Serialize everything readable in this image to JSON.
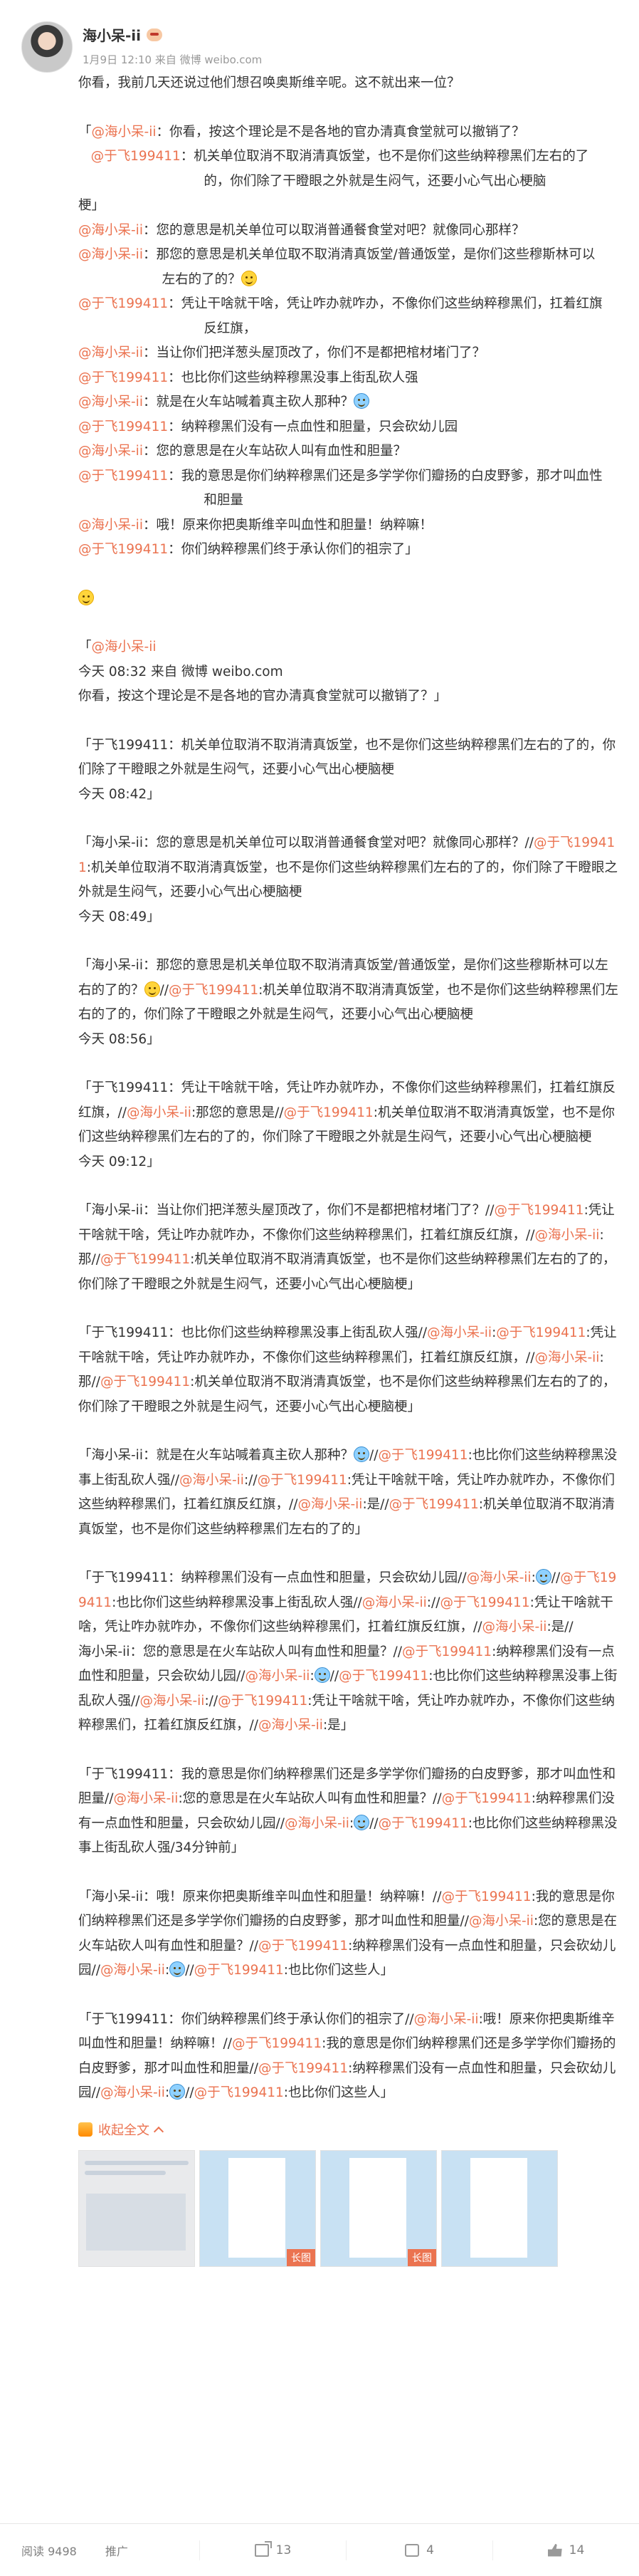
{
  "post": {
    "username": "海小呆-ii",
    "time_source": "1月9日 12:10 来自 微博 weibo.com",
    "icons": {
      "avatar": "avatar",
      "badge": "badge-icon",
      "emoji": "smile-emoji",
      "cry": "laugh-cry-emoji"
    }
  },
  "body": {
    "p01": "你看，我前几天还说过他们想召唤奥斯维辛呢。这不就出来一位？",
    "p02_a": "「",
    "p02_m1": "@海小呆-ii",
    "p02_b": "：你看，按这个理论是不是各地的官办清真食堂就可以撤销了？\n   ",
    "p02_m2": "@于飞199411",
    "p02_c": "：机关单位取消不取消清真饭堂，也不是你们这些纳粹穆黑们左右的了\n                              的，你们除了干瞪眼之外就是生闷气，还要小心气出心梗脑\n梗」",
    "p03_m": "@海小呆-ii",
    "p03_t": "：您的意思是机关单位可以取消普通餐食堂对吧？就像同心那样？",
    "p04_m": "@海小呆-ii",
    "p04_t": "：那您的意思是机关单位取不取消清真饭堂/普通饭堂，是你们这些穆斯林可以\n                    左右的了的？",
    "p05_m": "@于飞199411",
    "p05_t": "：凭让干啥就干啥，凭让咋办就咋办，不像你们这些纳粹穆黑们，扛着红旗\n                              反红旗，",
    "p06_m": "@海小呆-ii",
    "p06_t": "：当让你们把洋葱头屋顶改了，你们不是都把棺材堵门了？",
    "p07_m": "@于飞199411",
    "p07_t": "：也比你们这些纳粹穆黑没事上街乱砍人强",
    "p08_m": "@海小呆-ii",
    "p08_t": "：就是在火车站喊着真主砍人那种？",
    "p09_m": "@于飞199411",
    "p09_t": "：纳粹穆黑们没有一点血性和胆量，只会砍幼儿园",
    "p10_m": "@海小呆-ii",
    "p10_t": "：您的意思是在火车站砍人叫有血性和胆量？",
    "p11_m": "@于飞199411",
    "p11_t": "：我的意思是你们纳粹穆黑们还是多学学你们瓣扬的白皮野爹，那才叫血性\n                              和胆量",
    "p12_m": "@海小呆-ii",
    "p12_t": "：哦！原来你把奥斯维辛叫血性和胆量！纳粹嘛！",
    "p13_m": "@于飞199411",
    "p13_t": "：你们纳粹穆黑们终于承认你们的祖宗了」",
    "q01_m": "@海小呆-ii",
    "q01_time": "今天 08:32 来自 微博 weibo.com",
    "q01_t": "你看，按这个理论是不是各地的官办清真食堂就可以撤销了？」",
    "q02": "「于飞199411：机关单位取消不取消清真饭堂，也不是你们这些纳粹穆黑们左右的了的，你们除了干瞪眼之外就是生闷气，还要小心气出心梗脑梗",
    "q02_time": "今天 08:42」",
    "q03_a": "「海小呆-ii：您的意思是机关单位可以取消普通餐食堂对吧？就像同心那样？//",
    "q03_m": "@于飞199411",
    "q03_b": ":机关单位取消不取消清真饭堂，也不是你们这些纳粹穆黑们左右的了的，你们除了干瞪眼之外就是生闷气，还要小心气出心梗脑梗",
    "q03_time": "今天 08:49」",
    "q04_a": "「海小呆-ii：那您的意思是机关单位取不取消清真饭堂/普通饭堂，是你们这些穆斯林可以左右的了的？",
    "q04_b": "//",
    "q04_m": "@于飞199411",
    "q04_c": ":机关单位取消不取消清真饭堂，也不是你们这些纳粹穆黑们左右的了的，你们除了干瞪眼之外就是生闷气，还要小心气出心梗脑梗",
    "q04_time": "今天 08:56」",
    "q05_a": "「于飞199411：凭让干啥就干啥，凭让咋办就咋办，不像你们这些纳粹穆黑们，扛着红旗反红旗，//",
    "q05_m1": "@海小呆-ii",
    "q05_b": ":那您的意思是//",
    "q05_m2": "@于飞199411",
    "q05_c": ":机关单位取消不取消清真饭堂，也不是你们这些纳粹穆黑们左右的了的，你们除了干瞪眼之外就是生闷气，还要小心气出心梗脑梗",
    "q05_time": "今天 09:12」",
    "q06_a": "「海小呆-ii：当让你们把洋葱头屋顶改了，你们不是都把棺材堵门了？//",
    "q06_m1": "@于飞199411",
    "q06_b": ":凭让干啥就干啥，凭让咋办就咋办，不像你们这些纳粹穆黑们，扛着红旗反红旗，//",
    "q06_m2": "@海小呆-ii",
    "q06_c": ":那//",
    "q06_m3": "@于飞199411",
    "q06_d": ":机关单位取消不取消清真饭堂，也不是你们这些纳粹穆黑们左右的了的，你们除了干瞪眼之外就是生闷气，还要小心气出心梗脑梗」",
    "q07_a": "「于飞199411：也比你们这些纳粹穆黑没事上街乱砍人强//",
    "q07_m1": "@海小呆-ii",
    "q07_b": ":",
    "q07_m2": "@于飞199411",
    "q07_c": ":凭让干啥就干啥，凭让咋办就咋办，不像你们这些纳粹穆黑们，扛着红旗反红旗，//",
    "q07_m3": "@海小呆-ii",
    "q07_d": ":那//",
    "q07_m4": "@于飞199411",
    "q07_e": ":机关单位取消不取消清真饭堂，也不是你们这些纳粹穆黑们左右的了的，你们除了干瞪眼之外就是生闷气，还要小心气出心梗脑梗」",
    "q08_a": "「海小呆-ii：就是在火车站喊着真主砍人那种？",
    "q08_b": "//",
    "q08_m1": "@于飞199411",
    "q08_c": ":也比你们这些纳粹穆黑没事上街乱砍人强//",
    "q08_m2": "@海小呆-ii",
    "q08_d": "://",
    "q08_m3": "@于飞199411",
    "q08_e": ":凭让干啥就干啥，凭让咋办就咋办，不像你们这些纳粹穆黑们，扛着红旗反红旗，//",
    "q08_m4": "@海小呆-ii",
    "q08_f": ":是//",
    "q08_m5": "@于飞199411",
    "q08_g": ":机关单位取消不取消清真饭堂，也不是你们这些纳粹穆黑们左右的了的」",
    "q09_a": "「于飞199411：纳粹穆黑们没有一点血性和胆量，只会砍幼儿园//",
    "q09_m1": "@海小呆-ii",
    "q09_b": ":",
    "q09_c": "//",
    "q09_m2": "@于飞199411",
    "q09_d": ":也比你们这些纳粹穆黑没事上街乱砍人强//",
    "q09_m3": "@海小呆-ii",
    "q09_e": "://",
    "q09_m4": "@于飞199411",
    "q09_f": ":凭让干啥就干啥，凭让咋办就咋办，不像你们这些纳粹穆黑们，扛着红旗反红旗，//",
    "q09_m5": "@海小呆-ii",
    "q09_g": ":是//\n海小呆-ii：您的意思是在火车站砍人叫有血性和胆量？//",
    "q09_m6": "@于飞199411",
    "q09_h": ":纳粹穆黑们没有一点血性和胆量，只会砍幼儿园//",
    "q09_m7": "@海小呆-ii",
    "q09_i": ":",
    "q09_j": "//",
    "q09_m8": "@于飞199411",
    "q09_k": ":也比你们这些纳粹穆黑没事上街乱砍人强//",
    "q09_m9": "@海小呆-ii",
    "q09_l": "://",
    "q09_m10": "@于飞199411",
    "q09_n": ":凭让干啥就干啥，凭让咋办就咋办，不像你们这些纳粹穆黑们，扛着红旗反红旗，//",
    "q09_m11": "@海小呆-ii",
    "q09_o": ":是」",
    "q10_a": "「于飞199411：我的意思是你们纳粹穆黑们还是多学学你们瓣扬的白皮野爹，那才叫血性和胆量//",
    "q10_m1": "@海小呆-ii",
    "q10_b": ":您的意思是在火车站砍人叫有血性和胆量？//",
    "q10_m2": "@于飞199411",
    "q10_c": ":纳粹穆黑们没有一点血性和胆量，只会砍幼儿园//",
    "q10_m3": "@海小呆-ii",
    "q10_d": ":",
    "q10_e": "//",
    "q10_m4": "@于飞199411",
    "q10_f": ":也比你们这些纳粹穆黑没事上街乱砍人强/34分钟前」",
    "q11_a": "「海小呆-ii：哦！原来你把奥斯维辛叫血性和胆量！纳粹嘛！//",
    "q11_m1": "@于飞199411",
    "q11_b": ":我的意思是你们纳粹穆黑们还是多学学你们瓣扬的白皮野爹，那才叫血性和胆量//",
    "q11_m2": "@海小呆-ii",
    "q11_c": ":您的意思是在火车站砍人叫有血性和胆量？//",
    "q11_m3": "@于飞199411",
    "q11_d": ":纳粹穆黑们没有一点血性和胆量，只会砍幼儿园//",
    "q11_m4": "@海小呆-ii",
    "q11_e": ":",
    "q11_f": "//",
    "q11_m5": "@于飞199411",
    "q11_g": ":也比你们这些人」",
    "q12_a": "「于飞199411：你们纳粹穆黑们终于承认你们的祖宗了//",
    "q12_m1": "@海小呆-ii",
    "q12_b": ":哦！原来你把奥斯维辛叫血性和胆量！纳粹嘛！//",
    "q12_m2": "@于飞199411",
    "q12_c": ":我的意思是你们纳粹穆黑们还是多学学你们瓣扬的白皮野爹，那才叫血性和胆量//",
    "q12_m3": "@于飞199411",
    "q12_d": ":纳粹穆黑们没有一点血性和胆量，只会砍幼儿园//",
    "q12_m4": "@海小呆-ii",
    "q12_e": ":",
    "q12_f": "//",
    "q12_m5": "@于飞199411",
    "q12_g": ":也比你们这些人」"
  },
  "collapse_label": "收起全文",
  "thumbnails": [
    {
      "tag": ""
    },
    {
      "tag": "长图"
    },
    {
      "tag": "长图"
    },
    {
      "tag": ""
    }
  ],
  "footer": {
    "read_count": "阅读 9498",
    "promote": "推广",
    "share_count": "13",
    "comment_count": "4",
    "like_count": "14"
  },
  "colors": {
    "mention": "#eb7350",
    "text": "#333333",
    "meta": "#999999"
  }
}
